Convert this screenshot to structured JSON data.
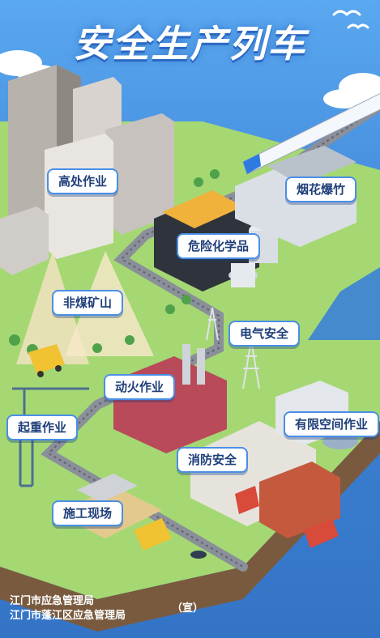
{
  "title": "安全生产列车",
  "stations": [
    {
      "id": "high-altitude",
      "label": "高处作业"
    },
    {
      "id": "fireworks",
      "label": "烟花爆竹"
    },
    {
      "id": "hazardous-chemicals",
      "label": "危险化学品"
    },
    {
      "id": "non-coal-mine",
      "label": "非煤矿山"
    },
    {
      "id": "electrical-safety",
      "label": "电气安全"
    },
    {
      "id": "hot-work",
      "label": "动火作业"
    },
    {
      "id": "lifting",
      "label": "起重作业"
    },
    {
      "id": "confined-space",
      "label": "有限空间作业"
    },
    {
      "id": "fire-safety",
      "label": "消防安全"
    },
    {
      "id": "construction-site",
      "label": "施工现场"
    }
  ],
  "footer": {
    "line1": "江门市应急管理局",
    "line2": "江门市蓬江区应急管理局",
    "tag": "（宣）"
  },
  "colors": {
    "sky": "#4a95e6",
    "ground": "#9fd36a",
    "water": "#3f86d8",
    "label_border": "#4a8fe6",
    "label_text": "#1f3f7a"
  }
}
